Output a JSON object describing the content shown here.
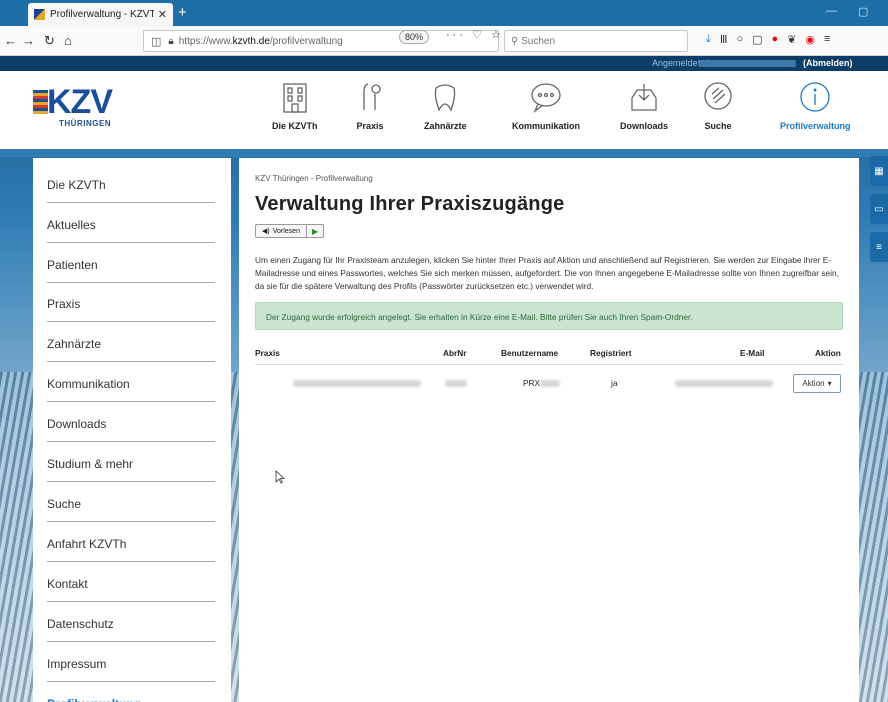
{
  "browser": {
    "tab_title": "Profilverwaltung - KZVThüringen",
    "tab_close": "✕",
    "new_tab": "+",
    "url_prefix": "https://www.",
    "url_domain": "kzvth.de",
    "url_path": "/profilverwaltung",
    "zoom": "80%",
    "url_tools": "··· ♡ ☆",
    "search_placeholder": "Suchen",
    "minimize": "—",
    "maximize": "▢"
  },
  "login": {
    "label": "Angemeldet als",
    "logout": "(Abmelden)"
  },
  "logo": {
    "main": "KZV",
    "sub": "THÜRINGEN"
  },
  "topnav": [
    {
      "label": "Die KZVTh",
      "icon": "building-icon"
    },
    {
      "label": "Praxis",
      "icon": "dental-tools-icon"
    },
    {
      "label": "Zahnärzte",
      "icon": "tooth-icon"
    },
    {
      "label": "Kommunikation",
      "icon": "chat-bubble-icon"
    },
    {
      "label": "Downloads",
      "icon": "download-tray-icon"
    },
    {
      "label": "Suche",
      "icon": "search-icon"
    },
    {
      "label": "Profilverwaltung",
      "icon": "info-icon",
      "active": true
    }
  ],
  "sidenav": [
    "Die KZVTh",
    "Aktuelles",
    "Patienten",
    "Praxis",
    "Zahnärzte",
    "Kommunikation",
    "Downloads",
    "Studium & mehr",
    "Suche",
    "Anfahrt KZVTh",
    "Kontakt",
    "Datenschutz",
    "Impressum",
    "Profilverwaltung"
  ],
  "main": {
    "breadcrumb": "KZV Thüringen - Profilverwaltung",
    "title": "Verwaltung Ihrer Praxiszugänge",
    "read_label": "Vorlesen",
    "intro": "Um einen Zugang für Ihr Praxisteam anzulegen, klicken Sie hinter Ihrer Praxis auf Aktion und anschließend auf Registrieren. Sie werden zur Eingabe ihrer E-Mailadresse und eines Passwortes, welches Sie sich merken müssen, aufgefordert. Die von Ihnen angegebene E-Mailadresse sollte von Ihnen zugreifbar sein, da sie für die spätere Verwaltung des Profils (Passwörter zurücksetzen etc.) verwendet wird.",
    "alert": "Der Zugang wurde erfolgreich angelegt. Sie erhalten in Kürze eine E-Mail. Bitte prüfen Sie auch Ihren Spam-Ordner.",
    "columns": {
      "praxis": "Praxis",
      "abrnr": "AbrNr",
      "benutzername": "Benutzername",
      "registriert": "Registriert",
      "email": "E-Mail",
      "aktion": "Aktion"
    },
    "row": {
      "benutzername": "PRX",
      "registriert": "ja",
      "aktion_button": "Aktion"
    }
  },
  "colors": {
    "accent": "#1b7bc8",
    "brand": "#1c4f9a",
    "alert_bg": "#c9e4cf",
    "alert_text": "#2f6b3b"
  }
}
